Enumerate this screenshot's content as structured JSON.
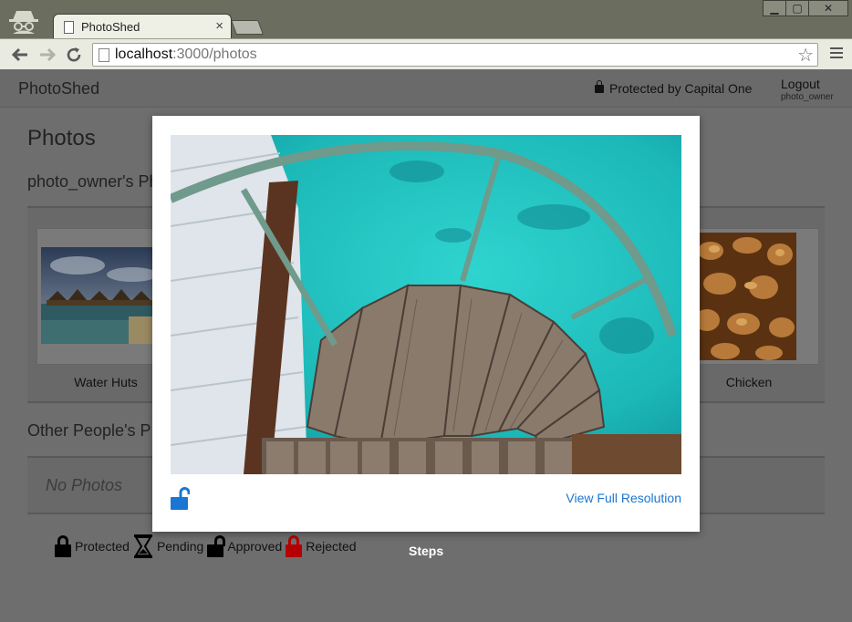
{
  "browser": {
    "tab_title": "PhotoShed",
    "tab_close": "×",
    "url_host": "localhost",
    "url_rest": ":3000/photos",
    "window_controls": {
      "minimize": "▁",
      "maximize": "▢",
      "close": "✕"
    },
    "icons": [
      "incognito-icon",
      "page-icon",
      "back-arrow-icon",
      "forward-arrow-icon",
      "reload-icon",
      "bookmark-star-icon",
      "menu-icon"
    ]
  },
  "navbar": {
    "brand": "PhotoShed",
    "protected_label": "Protected by Capital One",
    "logout": "Logout",
    "username": "photo_owner"
  },
  "main": {
    "heading": "Photos",
    "owner_section_title": "photo_owner's Ph",
    "owner_photos": [
      {
        "caption": "Water Huts"
      },
      {
        "caption": "Chicken"
      }
    ],
    "others_section_title": "Other People's P",
    "others_empty": "No Photos"
  },
  "legend": [
    {
      "label": "Protected",
      "icon": "locked-padlock-icon"
    },
    {
      "label": "Pending",
      "icon": "hourglass-icon"
    },
    {
      "label": "Approved",
      "icon": "unlocked-padlock-icon"
    },
    {
      "label": "Rejected",
      "icon": "red-padlock-icon"
    }
  ],
  "steps_label": "Steps",
  "modal": {
    "photo_subject": "spiral wooden staircase over turquoise water",
    "status_icon": "unlocked-padlock-icon",
    "status_color": "#1a76d2",
    "full_resolution_link": "View Full Resolution"
  }
}
